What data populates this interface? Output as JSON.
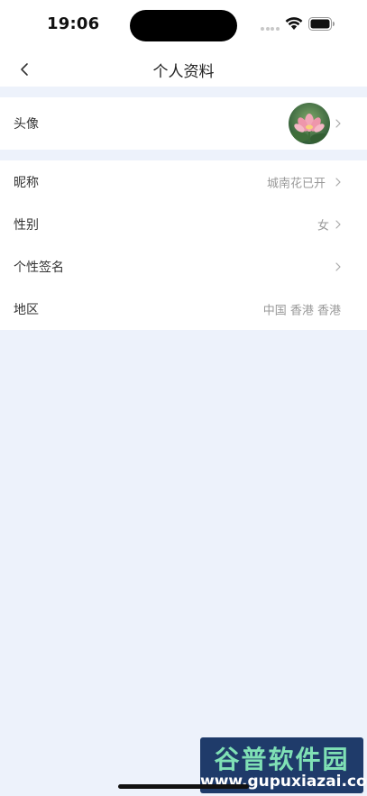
{
  "status_bar": {
    "time": "19:06"
  },
  "nav": {
    "title": "个人资料",
    "back_icon": "chevron-left-icon"
  },
  "avatar_row": {
    "label": "头像",
    "avatar_icon": "lotus-avatar-image"
  },
  "info_rows": [
    {
      "label": "昵称",
      "value": "城南花已开"
    },
    {
      "label": "性别",
      "value": "女"
    },
    {
      "label": "个性签名",
      "value": ""
    },
    {
      "label": "地区",
      "value": "中国 香港 香港"
    }
  ],
  "watermark": {
    "title": "谷普软件园",
    "url": "www.gupuxiazai.com"
  },
  "colors": {
    "page_background": "#edf2fb",
    "card_background": "#ffffff",
    "label_text": "#333333",
    "value_text": "#999999",
    "watermark_background": "#1f3b6a",
    "watermark_title": "#7fe0b5"
  }
}
